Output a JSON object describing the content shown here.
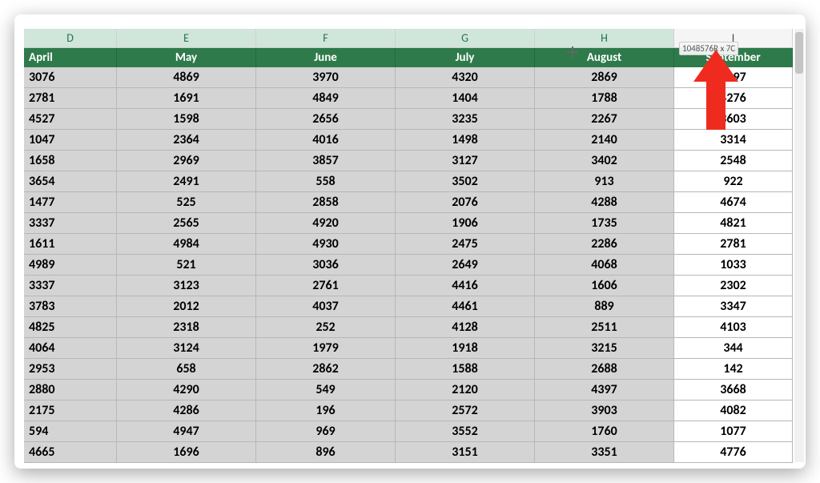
{
  "columns": [
    {
      "letter": "D",
      "month": "April",
      "width_class": "w-d",
      "selected": true,
      "align_first": true
    },
    {
      "letter": "E",
      "month": "May",
      "width_class": "w-e",
      "selected": true,
      "align_first": false
    },
    {
      "letter": "F",
      "month": "June",
      "width_class": "w-f",
      "selected": true,
      "align_first": false
    },
    {
      "letter": "G",
      "month": "July",
      "width_class": "w-g",
      "selected": true,
      "align_first": false
    },
    {
      "letter": "H",
      "month": "August",
      "width_class": "w-h",
      "selected": true,
      "align_first": false
    },
    {
      "letter": "I",
      "month": "September",
      "width_class": "w-i",
      "selected": false,
      "align_first": false
    }
  ],
  "selection_tip": "1048576R x 7C",
  "rows": [
    [
      3076,
      4869,
      3970,
      4320,
      2869,
      2097
    ],
    [
      2781,
      1691,
      4849,
      1404,
      1788,
      4276
    ],
    [
      4527,
      1598,
      2656,
      3235,
      2267,
      3603
    ],
    [
      1047,
      2364,
      4016,
      1498,
      2140,
      3314
    ],
    [
      1658,
      2969,
      3857,
      3127,
      3402,
      2548
    ],
    [
      3654,
      2491,
      558,
      3502,
      913,
      922
    ],
    [
      1477,
      525,
      2858,
      2076,
      4288,
      4674
    ],
    [
      3337,
      2565,
      4920,
      1906,
      1735,
      4821
    ],
    [
      1611,
      4984,
      4930,
      2475,
      2286,
      2781
    ],
    [
      4989,
      521,
      3036,
      2649,
      4068,
      1033
    ],
    [
      3337,
      3123,
      2761,
      4416,
      1606,
      2302
    ],
    [
      3783,
      2012,
      4037,
      4461,
      889,
      3347
    ],
    [
      4825,
      2318,
      252,
      4128,
      2511,
      4103
    ],
    [
      4064,
      3124,
      1979,
      1918,
      3215,
      344
    ],
    [
      2953,
      658,
      2862,
      1588,
      2688,
      142
    ],
    [
      2880,
      4290,
      549,
      2120,
      4397,
      3668
    ],
    [
      2175,
      4286,
      196,
      2572,
      3903,
      4082
    ],
    [
      594,
      4947,
      969,
      3552,
      1760,
      1077
    ],
    [
      4665,
      1696,
      896,
      3151,
      3351,
      4776
    ]
  ],
  "chart_data": {
    "type": "table",
    "title": "",
    "columns": [
      "April",
      "May",
      "June",
      "July",
      "August",
      "September"
    ],
    "rows": [
      [
        3076,
        4869,
        3970,
        4320,
        2869,
        2097
      ],
      [
        2781,
        1691,
        4849,
        1404,
        1788,
        4276
      ],
      [
        4527,
        1598,
        2656,
        3235,
        2267,
        3603
      ],
      [
        1047,
        2364,
        4016,
        1498,
        2140,
        3314
      ],
      [
        1658,
        2969,
        3857,
        3127,
        3402,
        2548
      ],
      [
        3654,
        2491,
        558,
        3502,
        913,
        922
      ],
      [
        1477,
        525,
        2858,
        2076,
        4288,
        4674
      ],
      [
        3337,
        2565,
        4920,
        1906,
        1735,
        4821
      ],
      [
        1611,
        4984,
        4930,
        2475,
        2286,
        2781
      ],
      [
        4989,
        521,
        3036,
        2649,
        4068,
        1033
      ],
      [
        3337,
        3123,
        2761,
        4416,
        1606,
        2302
      ],
      [
        3783,
        2012,
        4037,
        4461,
        889,
        3347
      ],
      [
        4825,
        2318,
        252,
        4128,
        2511,
        4103
      ],
      [
        4064,
        3124,
        1979,
        1918,
        3215,
        344
      ],
      [
        2953,
        658,
        2862,
        1588,
        2688,
        142
      ],
      [
        2880,
        4290,
        549,
        2120,
        4397,
        3668
      ],
      [
        2175,
        4286,
        196,
        2572,
        3903,
        4082
      ],
      [
        594,
        4947,
        969,
        3552,
        1760,
        1077
      ],
      [
        4665,
        1696,
        896,
        3151,
        3351,
        4776
      ]
    ]
  },
  "colors": {
    "header_green": "#2f7a4b",
    "selected_col_header": "#d0e6da",
    "cell_selected_bg": "#d4d4d4"
  }
}
